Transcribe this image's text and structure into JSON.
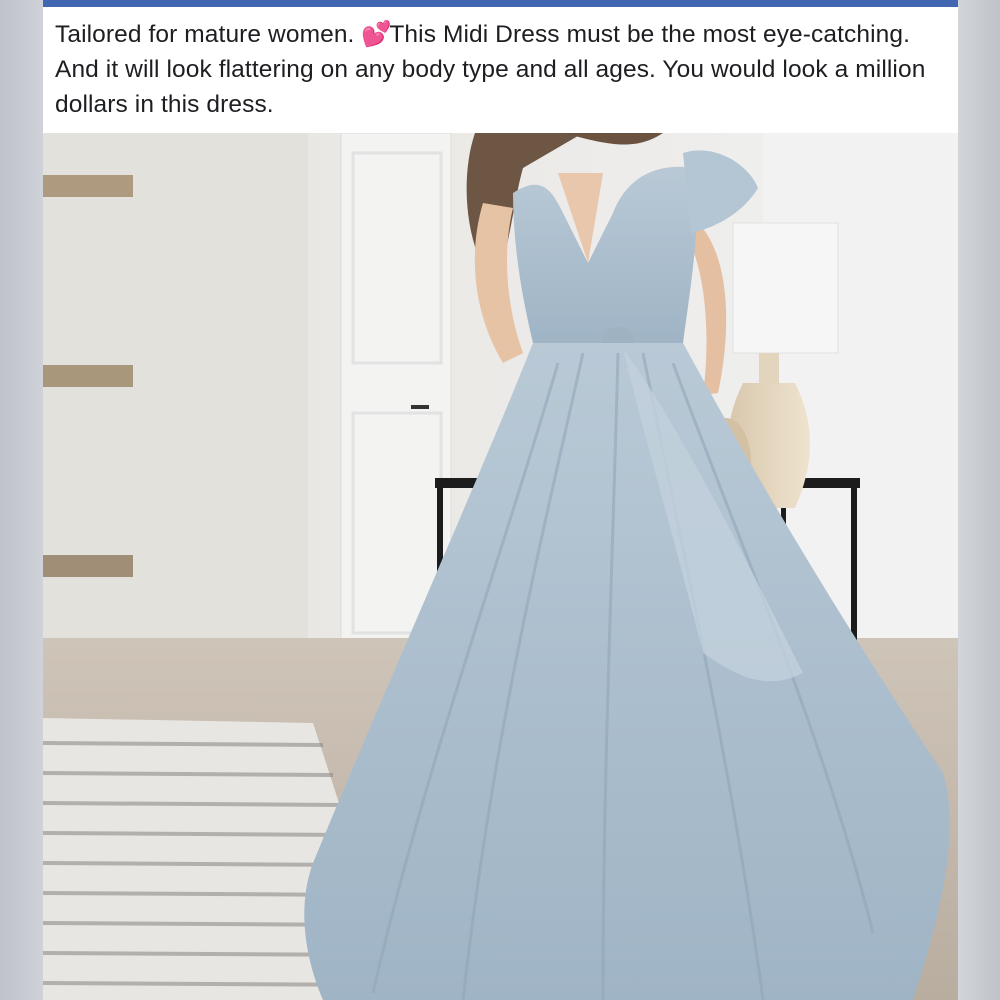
{
  "post": {
    "text_before_emoji": "Tailored for mature women. ",
    "emoji": "💕",
    "text_after_emoji": "This Midi Dress must be the most eye-catching. And it will look flattering on any body type and all ages. You would look a million dollars in this dress."
  },
  "photo": {
    "subject": "light blue v-neck flutter-sleeve maxi dress",
    "dress_color": "#a9bdcc",
    "accent_color": "#4267b2"
  }
}
